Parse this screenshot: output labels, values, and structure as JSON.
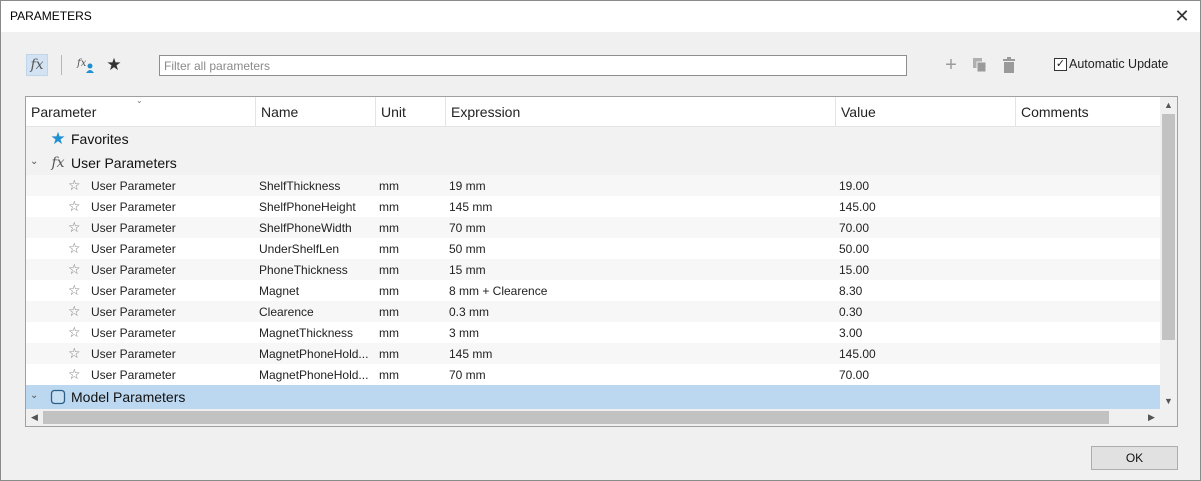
{
  "window": {
    "title": "PARAMETERS",
    "close_glyph": "✕"
  },
  "toolbar": {
    "fx_glyph": "fx",
    "user_fx_glyph": "fx",
    "favorite_glyph": "★",
    "filter_placeholder": "Filter all parameters",
    "filter_value": "",
    "add_glyph": "+",
    "copy_glyph": "❐",
    "delete_glyph": "🗑",
    "auto_update_label": "Automatic Update",
    "auto_update_checked": true,
    "check_glyph": "✓"
  },
  "columns": [
    "Parameter",
    "Name",
    "Unit",
    "Expression",
    "Value",
    "Comments"
  ],
  "groups": {
    "favorites": {
      "label": "Favorites",
      "icon": "star-icon",
      "glyph": "★"
    },
    "user": {
      "label": "User Parameters",
      "icon": "fx-icon",
      "glyph": "fx",
      "toggle": "⌄"
    },
    "model": {
      "label": "Model Parameters",
      "icon": "body-icon",
      "toggle": "⌄"
    }
  },
  "user_parameters": [
    {
      "type": "User Parameter",
      "name": "ShelfThickness",
      "unit": "mm",
      "expression": "19 mm",
      "value": "19.00",
      "comment": ""
    },
    {
      "type": "User Parameter",
      "name": "ShelfPhoneHeight",
      "unit": "mm",
      "expression": "145 mm",
      "value": "145.00",
      "comment": ""
    },
    {
      "type": "User Parameter",
      "name": "ShelfPhoneWidth",
      "unit": "mm",
      "expression": "70 mm",
      "value": "70.00",
      "comment": ""
    },
    {
      "type": "User Parameter",
      "name": "UnderShelfLen",
      "unit": "mm",
      "expression": "50 mm",
      "value": "50.00",
      "comment": ""
    },
    {
      "type": "User Parameter",
      "name": "PhoneThickness",
      "unit": "mm",
      "expression": "15 mm",
      "value": "15.00",
      "comment": ""
    },
    {
      "type": "User Parameter",
      "name": "Magnet",
      "unit": "mm",
      "expression": "8 mm + Clearence",
      "value": "8.30",
      "comment": ""
    },
    {
      "type": "User Parameter",
      "name": "Clearence",
      "unit": "mm",
      "expression": "0.3 mm",
      "value": "0.30",
      "comment": ""
    },
    {
      "type": "User Parameter",
      "name": "MagnetThickness",
      "unit": "mm",
      "expression": "3 mm",
      "value": "3.00",
      "comment": ""
    },
    {
      "type": "User Parameter",
      "name": "MagnetPhoneHold...",
      "unit": "mm",
      "expression": "145 mm",
      "value": "145.00",
      "comment": ""
    },
    {
      "type": "User Parameter",
      "name": "MagnetPhoneHold...",
      "unit": "mm",
      "expression": "70 mm",
      "value": "70.00",
      "comment": ""
    }
  ],
  "row_star_glyph": "☆",
  "scroll": {
    "up": "▲",
    "down": "▼",
    "left": "◀",
    "right": "▶"
  },
  "buttons": {
    "ok": "OK"
  },
  "colors": {
    "selected_row": "#bcd8f1",
    "accent_blue": "#1e8fd0"
  }
}
